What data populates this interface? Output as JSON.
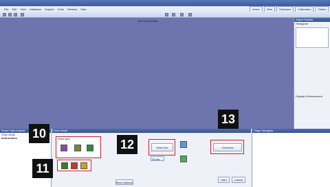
{
  "menubar": {
    "items": [
      "File",
      "Edit",
      "View",
      "Database",
      "Acquire",
      "Tools",
      "Window",
      "Help"
    ]
  },
  "tabs": [
    {
      "label": "Home"
    },
    {
      "label": "View"
    },
    {
      "label": "Database"
    },
    {
      "label": "Calibration"
    },
    {
      "label": "Tables"
    }
  ],
  "viewport": {
    "title": "[No Documents]"
  },
  "rightpanel": {
    "header": "Adjust Display",
    "section": "Histogram",
    "display_enhancement": "Display Enhancement"
  },
  "lower": {
    "left_header": "Smart Tabs Inspect",
    "left_tab": "Scan Mode",
    "instructions_title": "Instructions",
    "center_header": "Scan Mode",
    "scan_type_label": "Scan type",
    "overview_btn": "Overview",
    "start_live_btn": "Start Live",
    "start_btn": "Start",
    "cancel_btn": "Cancel",
    "more_options": "More Options",
    "zoom_value": "20 nm",
    "nav_header": "Stage Navigator"
  },
  "badges": {
    "b10": "10",
    "b11": "11",
    "b12": "12",
    "b13": "13"
  }
}
